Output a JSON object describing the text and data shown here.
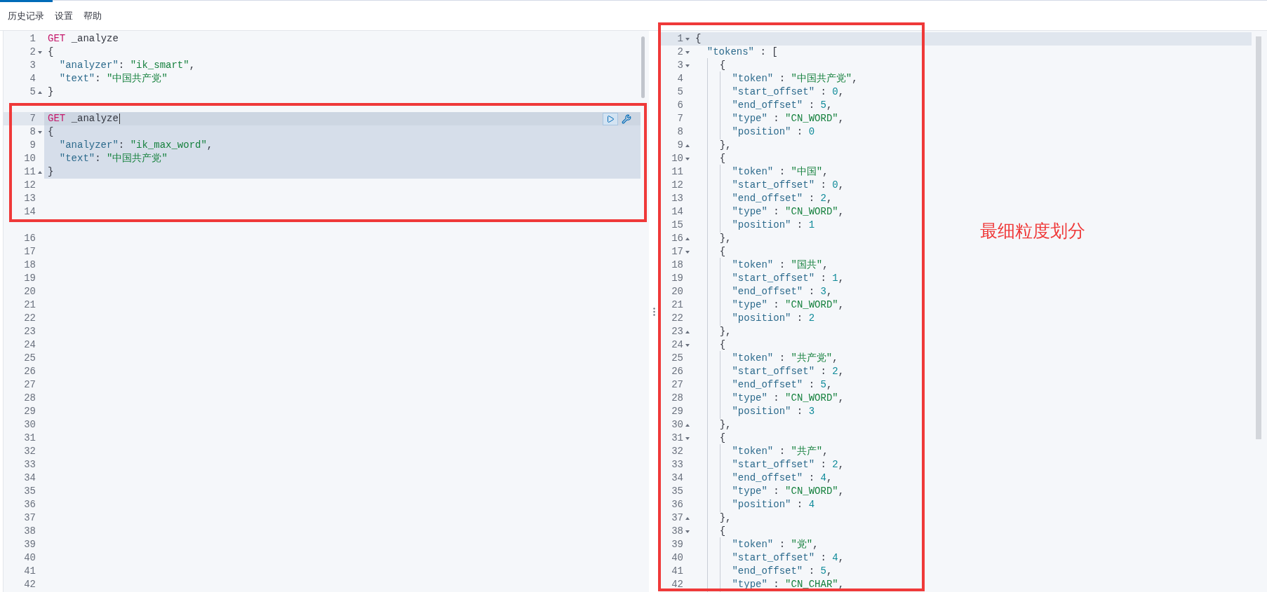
{
  "menu": [
    {
      "label": "历史记录"
    },
    {
      "label": "设置"
    },
    {
      "label": "帮助"
    }
  ],
  "request": {
    "lines": [
      {
        "number": "1",
        "kind": "plain",
        "cursor": false,
        "selected": false,
        "parts": [
          {
            "kind": "method",
            "text": "GET"
          },
          {
            "kind": "plain",
            "text": " _analyze"
          }
        ]
      },
      {
        "number": "2",
        "kind": "opener",
        "cursor": false,
        "selected": false,
        "parts": [
          {
            "kind": "plain",
            "text": "{"
          }
        ]
      },
      {
        "number": "3",
        "kind": "plain",
        "cursor": false,
        "selected": false,
        "parts": [
          {
            "kind": "key",
            "text": "  \"analyzer\""
          },
          {
            "kind": "plain",
            "text": ": "
          },
          {
            "kind": "string",
            "text": "\"ik_smart\""
          },
          {
            "kind": "plain",
            "text": ","
          }
        ]
      },
      {
        "number": "4",
        "kind": "plain",
        "cursor": false,
        "selected": false,
        "parts": [
          {
            "kind": "key",
            "text": "  \"text\""
          },
          {
            "kind": "plain",
            "text": ": "
          },
          {
            "kind": "string",
            "text": "\"中国共产党\""
          }
        ]
      },
      {
        "number": "5",
        "kind": "closer",
        "cursor": false,
        "selected": false,
        "parts": [
          {
            "kind": "plain",
            "text": "}"
          }
        ]
      },
      {
        "kind": "plain",
        "cursor": false,
        "selected": false
      },
      {
        "number": "7",
        "kind": "plain",
        "cursor": true,
        "selected": true,
        "parts": [
          {
            "kind": "method",
            "text": "GET"
          },
          {
            "kind": "plain",
            "text": " _analyze"
          }
        ]
      },
      {
        "number": "8",
        "kind": "opener",
        "cursor": false,
        "selected": true,
        "parts": [
          {
            "kind": "plain",
            "text": "{"
          }
        ]
      },
      {
        "number": "9",
        "kind": "plain",
        "cursor": false,
        "selected": true,
        "parts": [
          {
            "kind": "key",
            "text": "  \"analyzer\""
          },
          {
            "kind": "plain",
            "text": ": "
          },
          {
            "kind": "string",
            "text": "\"ik_max_word\""
          },
          {
            "kind": "plain",
            "text": ","
          }
        ]
      },
      {
        "number": "10",
        "kind": "plain",
        "cursor": false,
        "selected": true,
        "parts": [
          {
            "kind": "key",
            "text": "  \"text\""
          },
          {
            "kind": "plain",
            "text": ": "
          },
          {
            "kind": "string",
            "text": "\"中国共产党\""
          }
        ]
      },
      {
        "number": "11",
        "kind": "closer",
        "cursor": false,
        "selected": true,
        "parts": [
          {
            "kind": "plain",
            "text": "}"
          }
        ]
      },
      {
        "number": "12",
        "kind": "plain",
        "cursor": false,
        "selected": false
      },
      {
        "number": "13",
        "kind": "plain",
        "cursor": false,
        "selected": false
      },
      {
        "number": "14",
        "kind": "plain",
        "cursor": false,
        "selected": false
      },
      {
        "kind": "plain",
        "cursor": false,
        "selected": false
      },
      {
        "number": "16",
        "kind": "plain",
        "cursor": false,
        "selected": false
      },
      {
        "number": "17",
        "kind": "plain",
        "cursor": false,
        "selected": false
      },
      {
        "number": "18",
        "kind": "plain",
        "cursor": false,
        "selected": false
      },
      {
        "number": "19",
        "kind": "plain",
        "cursor": false,
        "selected": false
      },
      {
        "number": "20",
        "kind": "plain",
        "cursor": false,
        "selected": false
      },
      {
        "number": "21",
        "kind": "plain",
        "cursor": false,
        "selected": false
      },
      {
        "number": "22",
        "kind": "plain",
        "cursor": false,
        "selected": false
      },
      {
        "number": "23",
        "kind": "plain",
        "cursor": false,
        "selected": false
      },
      {
        "number": "24",
        "kind": "plain",
        "cursor": false,
        "selected": false
      },
      {
        "number": "25",
        "kind": "plain",
        "cursor": false,
        "selected": false
      },
      {
        "number": "26",
        "kind": "plain",
        "cursor": false,
        "selected": false
      },
      {
        "number": "27",
        "kind": "plain",
        "cursor": false,
        "selected": false
      },
      {
        "number": "28",
        "kind": "plain",
        "cursor": false,
        "selected": false
      },
      {
        "number": "29",
        "kind": "plain",
        "cursor": false,
        "selected": false
      },
      {
        "number": "30",
        "kind": "plain",
        "cursor": false,
        "selected": false
      },
      {
        "number": "31",
        "kind": "plain",
        "cursor": false,
        "selected": false
      },
      {
        "number": "32",
        "kind": "plain",
        "cursor": false,
        "selected": false
      },
      {
        "number": "33",
        "kind": "plain",
        "cursor": false,
        "selected": false
      },
      {
        "number": "34",
        "kind": "plain",
        "cursor": false,
        "selected": false
      },
      {
        "number": "35",
        "kind": "plain",
        "cursor": false,
        "selected": false
      },
      {
        "number": "36",
        "kind": "plain",
        "cursor": false,
        "selected": false
      },
      {
        "number": "37",
        "kind": "plain",
        "cursor": false,
        "selected": false
      },
      {
        "number": "38",
        "kind": "plain",
        "cursor": false,
        "selected": false
      },
      {
        "number": "39",
        "kind": "plain",
        "cursor": false,
        "selected": false
      },
      {
        "number": "40",
        "kind": "plain",
        "cursor": false,
        "selected": false
      },
      {
        "number": "41",
        "kind": "plain",
        "cursor": false,
        "selected": false
      },
      {
        "number": "42",
        "kind": "plain",
        "cursor": false,
        "selected": false
      }
    ]
  },
  "response": {
    "lines": [
      {
        "number": "1",
        "kind": "opener",
        "cursor": true,
        "parts": [
          {
            "kind": "plain",
            "text": "{"
          }
        ]
      },
      {
        "number": "2",
        "kind": "opener",
        "cursor": false,
        "parts": [
          {
            "kind": "key",
            "text": "  \"tokens\""
          },
          {
            "kind": "plain",
            "text": " : ["
          }
        ]
      },
      {
        "number": "3",
        "kind": "opener",
        "cursor": false,
        "parts": [
          {
            "kind": "plain",
            "text": "    {"
          }
        ]
      },
      {
        "number": "4",
        "kind": "plain",
        "cursor": false,
        "parts": [
          {
            "kind": "key",
            "text": "      \"token\""
          },
          {
            "kind": "plain",
            "text": " : "
          },
          {
            "kind": "string",
            "text": "\"中国共产党\""
          },
          {
            "kind": "plain",
            "text": ","
          }
        ]
      },
      {
        "number": "5",
        "kind": "plain",
        "cursor": false,
        "parts": [
          {
            "kind": "key",
            "text": "      \"start_offset\""
          },
          {
            "kind": "plain",
            "text": " : "
          },
          {
            "kind": "number",
            "text": "0"
          },
          {
            "kind": "plain",
            "text": ","
          }
        ]
      },
      {
        "number": "6",
        "kind": "plain",
        "cursor": false,
        "parts": [
          {
            "kind": "key",
            "text": "      \"end_offset\""
          },
          {
            "kind": "plain",
            "text": " : "
          },
          {
            "kind": "number",
            "text": "5"
          },
          {
            "kind": "plain",
            "text": ","
          }
        ]
      },
      {
        "number": "7",
        "kind": "plain",
        "cursor": false,
        "parts": [
          {
            "kind": "key",
            "text": "      \"type\""
          },
          {
            "kind": "plain",
            "text": " : "
          },
          {
            "kind": "string",
            "text": "\"CN_WORD\""
          },
          {
            "kind": "plain",
            "text": ","
          }
        ]
      },
      {
        "number": "8",
        "kind": "plain",
        "cursor": false,
        "parts": [
          {
            "kind": "key",
            "text": "      \"position\""
          },
          {
            "kind": "plain",
            "text": " : "
          },
          {
            "kind": "number",
            "text": "0"
          }
        ]
      },
      {
        "number": "9",
        "kind": "closer",
        "cursor": false,
        "parts": [
          {
            "kind": "plain",
            "text": "    },"
          }
        ]
      },
      {
        "number": "10",
        "kind": "opener",
        "cursor": false,
        "parts": [
          {
            "kind": "plain",
            "text": "    {"
          }
        ]
      },
      {
        "number": "11",
        "kind": "plain",
        "cursor": false,
        "parts": [
          {
            "kind": "key",
            "text": "      \"token\""
          },
          {
            "kind": "plain",
            "text": " : "
          },
          {
            "kind": "string",
            "text": "\"中国\""
          },
          {
            "kind": "plain",
            "text": ","
          }
        ]
      },
      {
        "number": "12",
        "kind": "plain",
        "cursor": false,
        "parts": [
          {
            "kind": "key",
            "text": "      \"start_offset\""
          },
          {
            "kind": "plain",
            "text": " : "
          },
          {
            "kind": "number",
            "text": "0"
          },
          {
            "kind": "plain",
            "text": ","
          }
        ]
      },
      {
        "number": "13",
        "kind": "plain",
        "cursor": false,
        "parts": [
          {
            "kind": "key",
            "text": "      \"end_offset\""
          },
          {
            "kind": "plain",
            "text": " : "
          },
          {
            "kind": "number",
            "text": "2"
          },
          {
            "kind": "plain",
            "text": ","
          }
        ]
      },
      {
        "number": "14",
        "kind": "plain",
        "cursor": false,
        "parts": [
          {
            "kind": "key",
            "text": "      \"type\""
          },
          {
            "kind": "plain",
            "text": " : "
          },
          {
            "kind": "string",
            "text": "\"CN_WORD\""
          },
          {
            "kind": "plain",
            "text": ","
          }
        ]
      },
      {
        "number": "15",
        "kind": "plain",
        "cursor": false,
        "parts": [
          {
            "kind": "key",
            "text": "      \"position\""
          },
          {
            "kind": "plain",
            "text": " : "
          },
          {
            "kind": "number",
            "text": "1"
          }
        ]
      },
      {
        "number": "16",
        "kind": "closer",
        "cursor": false,
        "parts": [
          {
            "kind": "plain",
            "text": "    },"
          }
        ]
      },
      {
        "number": "17",
        "kind": "opener",
        "cursor": false,
        "parts": [
          {
            "kind": "plain",
            "text": "    {"
          }
        ]
      },
      {
        "number": "18",
        "kind": "plain",
        "cursor": false,
        "parts": [
          {
            "kind": "key",
            "text": "      \"token\""
          },
          {
            "kind": "plain",
            "text": " : "
          },
          {
            "kind": "string",
            "text": "\"国共\""
          },
          {
            "kind": "plain",
            "text": ","
          }
        ]
      },
      {
        "number": "19",
        "kind": "plain",
        "cursor": false,
        "parts": [
          {
            "kind": "key",
            "text": "      \"start_offset\""
          },
          {
            "kind": "plain",
            "text": " : "
          },
          {
            "kind": "number",
            "text": "1"
          },
          {
            "kind": "plain",
            "text": ","
          }
        ]
      },
      {
        "number": "20",
        "kind": "plain",
        "cursor": false,
        "parts": [
          {
            "kind": "key",
            "text": "      \"end_offset\""
          },
          {
            "kind": "plain",
            "text": " : "
          },
          {
            "kind": "number",
            "text": "3"
          },
          {
            "kind": "plain",
            "text": ","
          }
        ]
      },
      {
        "number": "21",
        "kind": "plain",
        "cursor": false,
        "parts": [
          {
            "kind": "key",
            "text": "      \"type\""
          },
          {
            "kind": "plain",
            "text": " : "
          },
          {
            "kind": "string",
            "text": "\"CN_WORD\""
          },
          {
            "kind": "plain",
            "text": ","
          }
        ]
      },
      {
        "number": "22",
        "kind": "plain",
        "cursor": false,
        "parts": [
          {
            "kind": "key",
            "text": "      \"position\""
          },
          {
            "kind": "plain",
            "text": " : "
          },
          {
            "kind": "number",
            "text": "2"
          }
        ]
      },
      {
        "number": "23",
        "kind": "closer",
        "cursor": false,
        "parts": [
          {
            "kind": "plain",
            "text": "    },"
          }
        ]
      },
      {
        "number": "24",
        "kind": "opener",
        "cursor": false,
        "parts": [
          {
            "kind": "plain",
            "text": "    {"
          }
        ]
      },
      {
        "number": "25",
        "kind": "plain",
        "cursor": false,
        "parts": [
          {
            "kind": "key",
            "text": "      \"token\""
          },
          {
            "kind": "plain",
            "text": " : "
          },
          {
            "kind": "string",
            "text": "\"共产党\""
          },
          {
            "kind": "plain",
            "text": ","
          }
        ]
      },
      {
        "number": "26",
        "kind": "plain",
        "cursor": false,
        "parts": [
          {
            "kind": "key",
            "text": "      \"start_offset\""
          },
          {
            "kind": "plain",
            "text": " : "
          },
          {
            "kind": "number",
            "text": "2"
          },
          {
            "kind": "plain",
            "text": ","
          }
        ]
      },
      {
        "number": "27",
        "kind": "plain",
        "cursor": false,
        "parts": [
          {
            "kind": "key",
            "text": "      \"end_offset\""
          },
          {
            "kind": "plain",
            "text": " : "
          },
          {
            "kind": "number",
            "text": "5"
          },
          {
            "kind": "plain",
            "text": ","
          }
        ]
      },
      {
        "number": "28",
        "kind": "plain",
        "cursor": false,
        "parts": [
          {
            "kind": "key",
            "text": "      \"type\""
          },
          {
            "kind": "plain",
            "text": " : "
          },
          {
            "kind": "string",
            "text": "\"CN_WORD\""
          },
          {
            "kind": "plain",
            "text": ","
          }
        ]
      },
      {
        "number": "29",
        "kind": "plain",
        "cursor": false,
        "parts": [
          {
            "kind": "key",
            "text": "      \"position\""
          },
          {
            "kind": "plain",
            "text": " : "
          },
          {
            "kind": "number",
            "text": "3"
          }
        ]
      },
      {
        "number": "30",
        "kind": "closer",
        "cursor": false,
        "parts": [
          {
            "kind": "plain",
            "text": "    },"
          }
        ]
      },
      {
        "number": "31",
        "kind": "opener",
        "cursor": false,
        "parts": [
          {
            "kind": "plain",
            "text": "    {"
          }
        ]
      },
      {
        "number": "32",
        "kind": "plain",
        "cursor": false,
        "parts": [
          {
            "kind": "key",
            "text": "      \"token\""
          },
          {
            "kind": "plain",
            "text": " : "
          },
          {
            "kind": "string",
            "text": "\"共产\""
          },
          {
            "kind": "plain",
            "text": ","
          }
        ]
      },
      {
        "number": "33",
        "kind": "plain",
        "cursor": false,
        "parts": [
          {
            "kind": "key",
            "text": "      \"start_offset\""
          },
          {
            "kind": "plain",
            "text": " : "
          },
          {
            "kind": "number",
            "text": "2"
          },
          {
            "kind": "plain",
            "text": ","
          }
        ]
      },
      {
        "number": "34",
        "kind": "plain",
        "cursor": false,
        "parts": [
          {
            "kind": "key",
            "text": "      \"end_offset\""
          },
          {
            "kind": "plain",
            "text": " : "
          },
          {
            "kind": "number",
            "text": "4"
          },
          {
            "kind": "plain",
            "text": ","
          }
        ]
      },
      {
        "number": "35",
        "kind": "plain",
        "cursor": false,
        "parts": [
          {
            "kind": "key",
            "text": "      \"type\""
          },
          {
            "kind": "plain",
            "text": " : "
          },
          {
            "kind": "string",
            "text": "\"CN_WORD\""
          },
          {
            "kind": "plain",
            "text": ","
          }
        ]
      },
      {
        "number": "36",
        "kind": "plain",
        "cursor": false,
        "parts": [
          {
            "kind": "key",
            "text": "      \"position\""
          },
          {
            "kind": "plain",
            "text": " : "
          },
          {
            "kind": "number",
            "text": "4"
          }
        ]
      },
      {
        "number": "37",
        "kind": "closer",
        "cursor": false,
        "parts": [
          {
            "kind": "plain",
            "text": "    },"
          }
        ]
      },
      {
        "number": "38",
        "kind": "opener",
        "cursor": false,
        "parts": [
          {
            "kind": "plain",
            "text": "    {"
          }
        ]
      },
      {
        "number": "39",
        "kind": "plain",
        "cursor": false,
        "parts": [
          {
            "kind": "key",
            "text": "      \"token\""
          },
          {
            "kind": "plain",
            "text": " : "
          },
          {
            "kind": "string",
            "text": "\"党\""
          },
          {
            "kind": "plain",
            "text": ","
          }
        ]
      },
      {
        "number": "40",
        "kind": "plain",
        "cursor": false,
        "parts": [
          {
            "kind": "key",
            "text": "      \"start_offset\""
          },
          {
            "kind": "plain",
            "text": " : "
          },
          {
            "kind": "number",
            "text": "4"
          },
          {
            "kind": "plain",
            "text": ","
          }
        ]
      },
      {
        "number": "41",
        "kind": "plain",
        "cursor": false,
        "parts": [
          {
            "kind": "key",
            "text": "      \"end_offset\""
          },
          {
            "kind": "plain",
            "text": " : "
          },
          {
            "kind": "number",
            "text": "5"
          },
          {
            "kind": "plain",
            "text": ","
          }
        ]
      },
      {
        "number": "42",
        "kind": "plain",
        "cursor": false,
        "parts": [
          {
            "kind": "key",
            "text": "      \"type\""
          },
          {
            "kind": "plain",
            "text": " : "
          },
          {
            "kind": "string",
            "text": "\"CN_CHAR\""
          },
          {
            "kind": "plain",
            "text": ","
          }
        ]
      }
    ]
  },
  "annotation": {
    "label": "最细粒度划分"
  }
}
